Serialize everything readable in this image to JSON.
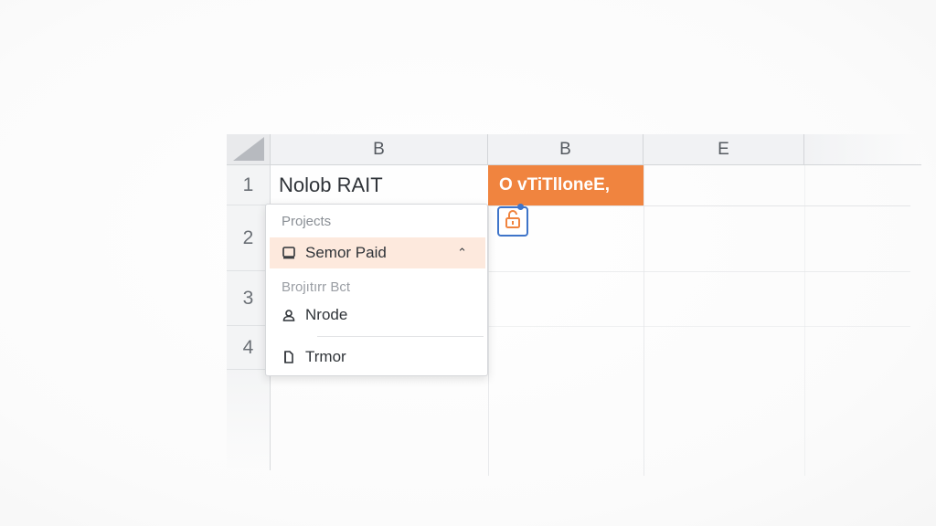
{
  "columns": {
    "c1": "B",
    "c2": "B",
    "c3": "E"
  },
  "rows": {
    "r1": "1",
    "r2": "2",
    "r3": "3",
    "r4": "4"
  },
  "cells": {
    "b1": "Nolob RAIT",
    "c1": "O vTiTlloneE,"
  },
  "dropdown": {
    "section1": "Projects",
    "item_selected": "Semor Paid",
    "section2": "Brojıtırr Bct",
    "item2": "Nrode",
    "item3": "Trmor"
  },
  "colors": {
    "accent": "#f0843f",
    "selected_bg": "#fde9dd",
    "lock_border": "#3e74c9"
  },
  "icons": {
    "lock": "lock-icon",
    "checkbox": "checkbox-icon",
    "user": "user-icon",
    "document": "document-icon",
    "chevron": "chevron-up-icon"
  }
}
